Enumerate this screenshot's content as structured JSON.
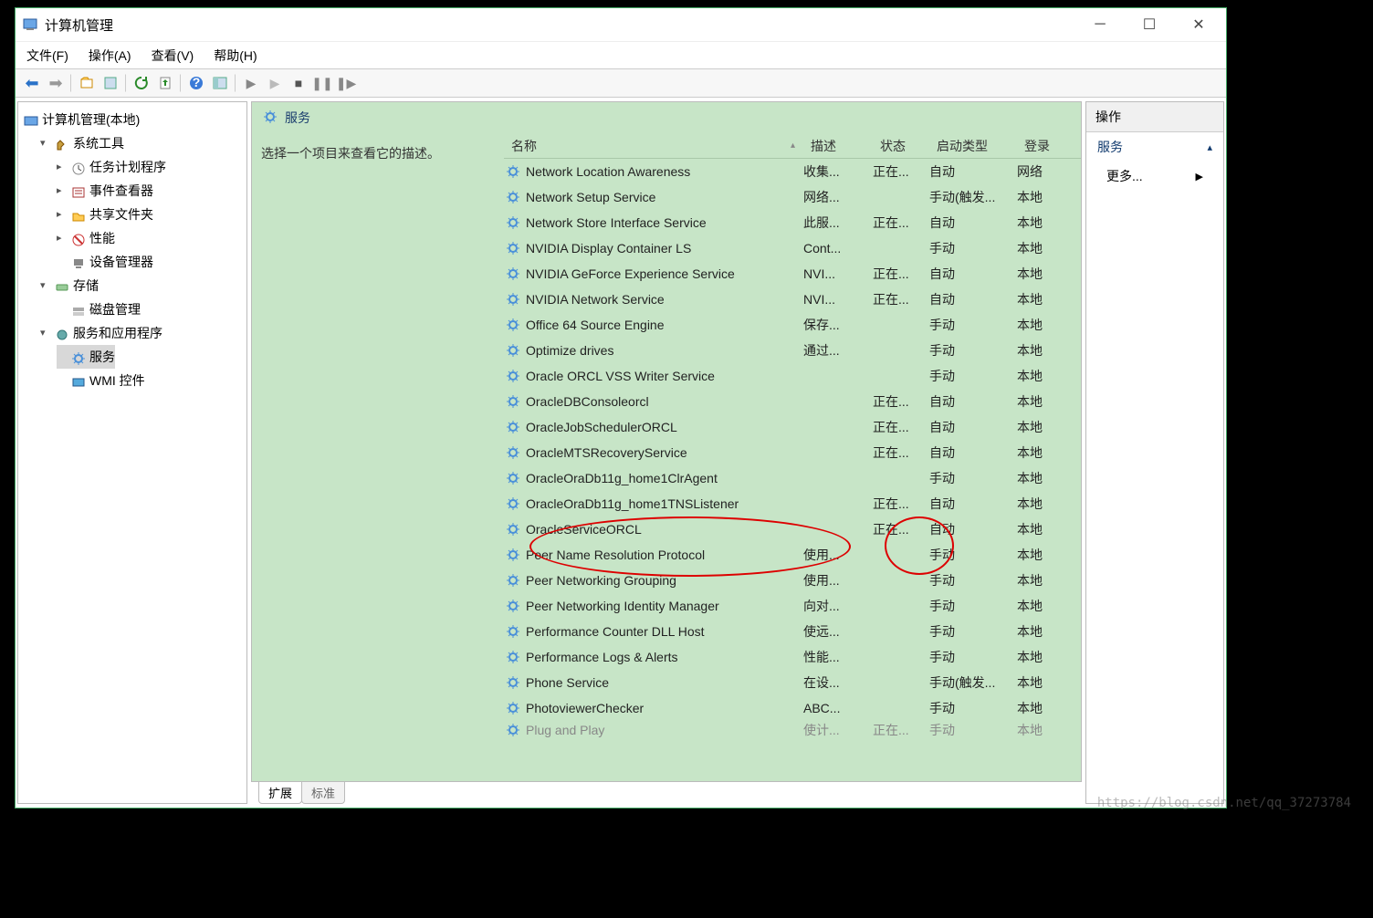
{
  "window": {
    "title": "计算机管理"
  },
  "menu": {
    "file": "文件(F)",
    "action": "操作(A)",
    "view": "查看(V)",
    "help": "帮助(H)"
  },
  "tree": {
    "root": "计算机管理(本地)",
    "system_tools": "系统工具",
    "task_sched": "任务计划程序",
    "event_viewer": "事件查看器",
    "shared_folders": "共享文件夹",
    "performance": "性能",
    "device_mgr": "设备管理器",
    "storage": "存储",
    "disk_mgmt": "磁盘管理",
    "services_apps": "服务和应用程序",
    "services": "服务",
    "wmi": "WMI 控件"
  },
  "svc_panel": {
    "title": "服务",
    "hint": "选择一个项目来查看它的描述。"
  },
  "columns": {
    "name": "名称",
    "desc": "描述",
    "status": "状态",
    "startup": "启动类型",
    "logon": "登录"
  },
  "services": [
    {
      "name": "Network Location Awareness",
      "desc": "收集...",
      "status": "正在...",
      "startup": "自动",
      "logon": "网络"
    },
    {
      "name": "Network Setup Service",
      "desc": "网络...",
      "status": "",
      "startup": "手动(触发...",
      "logon": "本地"
    },
    {
      "name": "Network Store Interface Service",
      "desc": "此服...",
      "status": "正在...",
      "startup": "自动",
      "logon": "本地"
    },
    {
      "name": "NVIDIA Display Container LS",
      "desc": "Cont...",
      "status": "",
      "startup": "手动",
      "logon": "本地"
    },
    {
      "name": "NVIDIA GeForce Experience Service",
      "desc": "NVI...",
      "status": "正在...",
      "startup": "自动",
      "logon": "本地"
    },
    {
      "name": "NVIDIA Network Service",
      "desc": "NVI...",
      "status": "正在...",
      "startup": "自动",
      "logon": "本地"
    },
    {
      "name": "Office 64 Source Engine",
      "desc": "保存...",
      "status": "",
      "startup": "手动",
      "logon": "本地"
    },
    {
      "name": "Optimize drives",
      "desc": "通过...",
      "status": "",
      "startup": "手动",
      "logon": "本地"
    },
    {
      "name": "Oracle ORCL VSS Writer Service",
      "desc": "",
      "status": "",
      "startup": "手动",
      "logon": "本地"
    },
    {
      "name": "OracleDBConsoleorcl",
      "desc": "",
      "status": "正在...",
      "startup": "自动",
      "logon": "本地"
    },
    {
      "name": "OracleJobSchedulerORCL",
      "desc": "",
      "status": "正在...",
      "startup": "自动",
      "logon": "本地"
    },
    {
      "name": "OracleMTSRecoveryService",
      "desc": "",
      "status": "正在...",
      "startup": "自动",
      "logon": "本地"
    },
    {
      "name": "OracleOraDb11g_home1ClrAgent",
      "desc": "",
      "status": "",
      "startup": "手动",
      "logon": "本地"
    },
    {
      "name": "OracleOraDb11g_home1TNSListener",
      "desc": "",
      "status": "正在...",
      "startup": "自动",
      "logon": "本地"
    },
    {
      "name": "OracleServiceORCL",
      "desc": "",
      "status": "正在...",
      "startup": "自动",
      "logon": "本地"
    },
    {
      "name": "Peer Name Resolution Protocol",
      "desc": "使用...",
      "status": "",
      "startup": "手动",
      "logon": "本地"
    },
    {
      "name": "Peer Networking Grouping",
      "desc": "使用...",
      "status": "",
      "startup": "手动",
      "logon": "本地"
    },
    {
      "name": "Peer Networking Identity Manager",
      "desc": "向对...",
      "status": "",
      "startup": "手动",
      "logon": "本地"
    },
    {
      "name": "Performance Counter DLL Host",
      "desc": "使远...",
      "status": "",
      "startup": "手动",
      "logon": "本地"
    },
    {
      "name": "Performance Logs & Alerts",
      "desc": "性能...",
      "status": "",
      "startup": "手动",
      "logon": "本地"
    },
    {
      "name": "Phone Service",
      "desc": "在设...",
      "status": "",
      "startup": "手动(触发...",
      "logon": "本地"
    },
    {
      "name": "PhotoviewerChecker",
      "desc": "ABC...",
      "status": "",
      "startup": "手动",
      "logon": "本地"
    },
    {
      "name": "Plug and Play",
      "desc": "使计...",
      "status": "正在...",
      "startup": "手动",
      "logon": "本地",
      "_partial": true
    }
  ],
  "tabs": {
    "extended": "扩展",
    "standard": "标准"
  },
  "actions": {
    "title": "操作",
    "services": "服务",
    "more": "更多..."
  },
  "watermark": "https://blog.csdn.net/qq_37273784"
}
